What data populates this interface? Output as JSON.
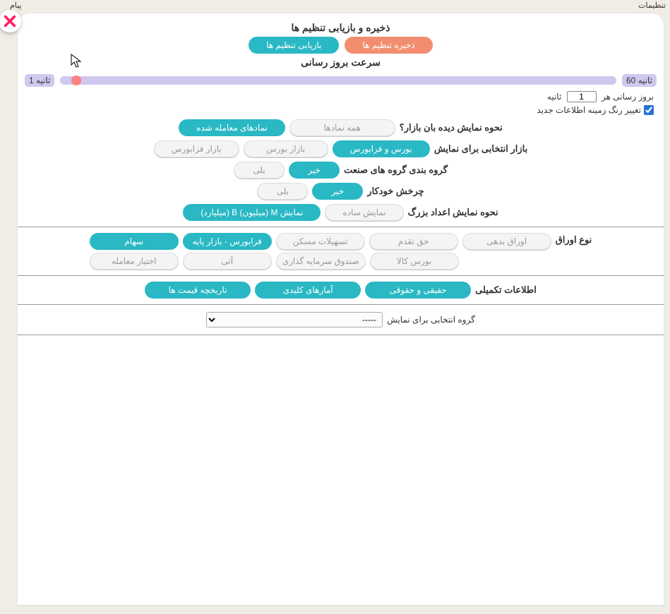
{
  "top": {
    "settings_label": "تنظیمات",
    "crumb": "پیام"
  },
  "panel": {
    "save_restore_title": "ذخیره و بازیابی تنظیم ها",
    "btn_save": "ذخیره تنظیم ها",
    "btn_restore": "بازیابی تنظیم ها",
    "speed_title": "سرعت بروز رسانی",
    "slider_min": "ثانیه 1",
    "slider_max": "ثانیه 60",
    "refresh_prefix": "بروز رسانی هر",
    "refresh_value": "1",
    "refresh_suffix": "ثانیه",
    "checkbox_bg": "تغییر رنگ زمینه اطلاعات جدید",
    "q_display_mode": "نحوه نمایش دیده بان بازار؟",
    "opt_all_symbols": "همه نمادها",
    "opt_traded_symbols": "نمادهای معامله شده",
    "q_market_select": "بازار انتخابی برای نمایش",
    "opt_bourse_fara": "بورس و فرابورس",
    "opt_bourse": "بازار بورس",
    "opt_farabourse": "بازار فرابورس",
    "q_industry_group": "گروه بندی گروه های صنعت",
    "opt_no": "خیر",
    "opt_yes": "بلی",
    "q_auto_rotate": "چرخش خودکار",
    "q_big_numbers": "نحوه نمایش اعداد بزرگ",
    "opt_simple": "نمایش ساده",
    "opt_mb": "نمایش M (میلیون) B (میلیارد)",
    "q_paper_type": "نوع اوراق",
    "pt_saham": "سهام",
    "pt_fara_payeh": "فرابورس - بازار پایه",
    "pt_maskan": "تسهیلات مسکن",
    "pt_taqaddom": "حق تقدم",
    "pt_debt": "اوراق بدهی",
    "pt_option": "اختیار معامله",
    "pt_ati": "آتی",
    "pt_fund": "صندوق سرمایه گذاری",
    "pt_commodity": "بورس کالا",
    "q_supplementary": "اطلاعات تکمیلی",
    "si_real_legal": "حقیقی و حقوقی",
    "si_key_stats": "آمارهای کلیدی",
    "si_price_history": "تاریخچه قیمت ها",
    "q_group_select": "گروه انتخابی برای نمایش",
    "group_placeholder": "-----"
  }
}
